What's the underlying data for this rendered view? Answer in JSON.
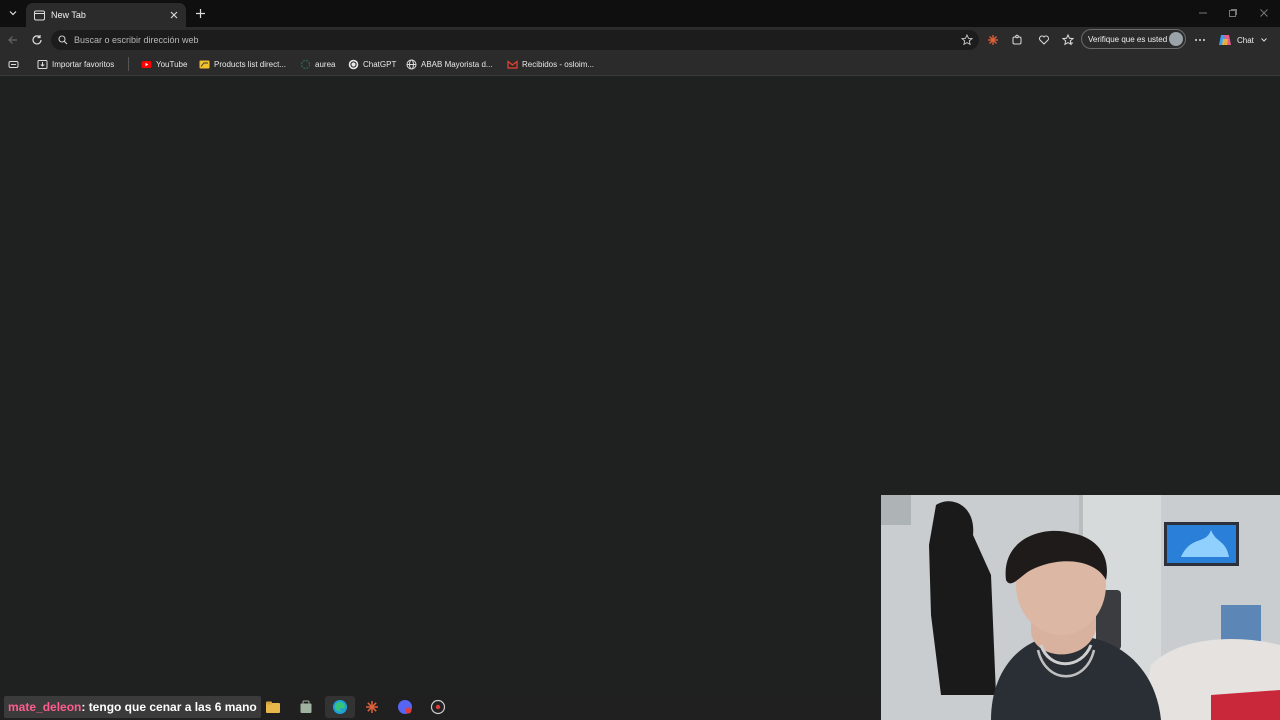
{
  "tabs": [
    {
      "title": "New Tab"
    }
  ],
  "address_bar": {
    "placeholder": "Buscar o escribir dirección web"
  },
  "profile": {
    "label": "Verifique que es usted"
  },
  "copilot": {
    "label": "Chat"
  },
  "bookmarks": [
    {
      "label": "Importar favoritos",
      "icon": "import-icon"
    },
    {
      "label": "YouTube",
      "icon": "youtube-icon"
    },
    {
      "label": "Products list direct...",
      "icon": "folder-icon"
    },
    {
      "label": "aurea",
      "icon": "aurea-icon"
    },
    {
      "label": "ChatGPT",
      "icon": "chatgpt-icon"
    },
    {
      "label": "ABAB Mayorista d...",
      "icon": "globe-icon"
    },
    {
      "label": "Recibidos - osloim...",
      "icon": "gmail-icon"
    }
  ],
  "chat_overlay": {
    "user": "mate_deleon",
    "message": ": tengo que cenar a las 6 mano"
  },
  "colors": {
    "background": "#1f2121",
    "tabstrip": "#0f0f0f",
    "toolbar": "#2b2b2b",
    "chat_user": "#ff5d8f"
  }
}
